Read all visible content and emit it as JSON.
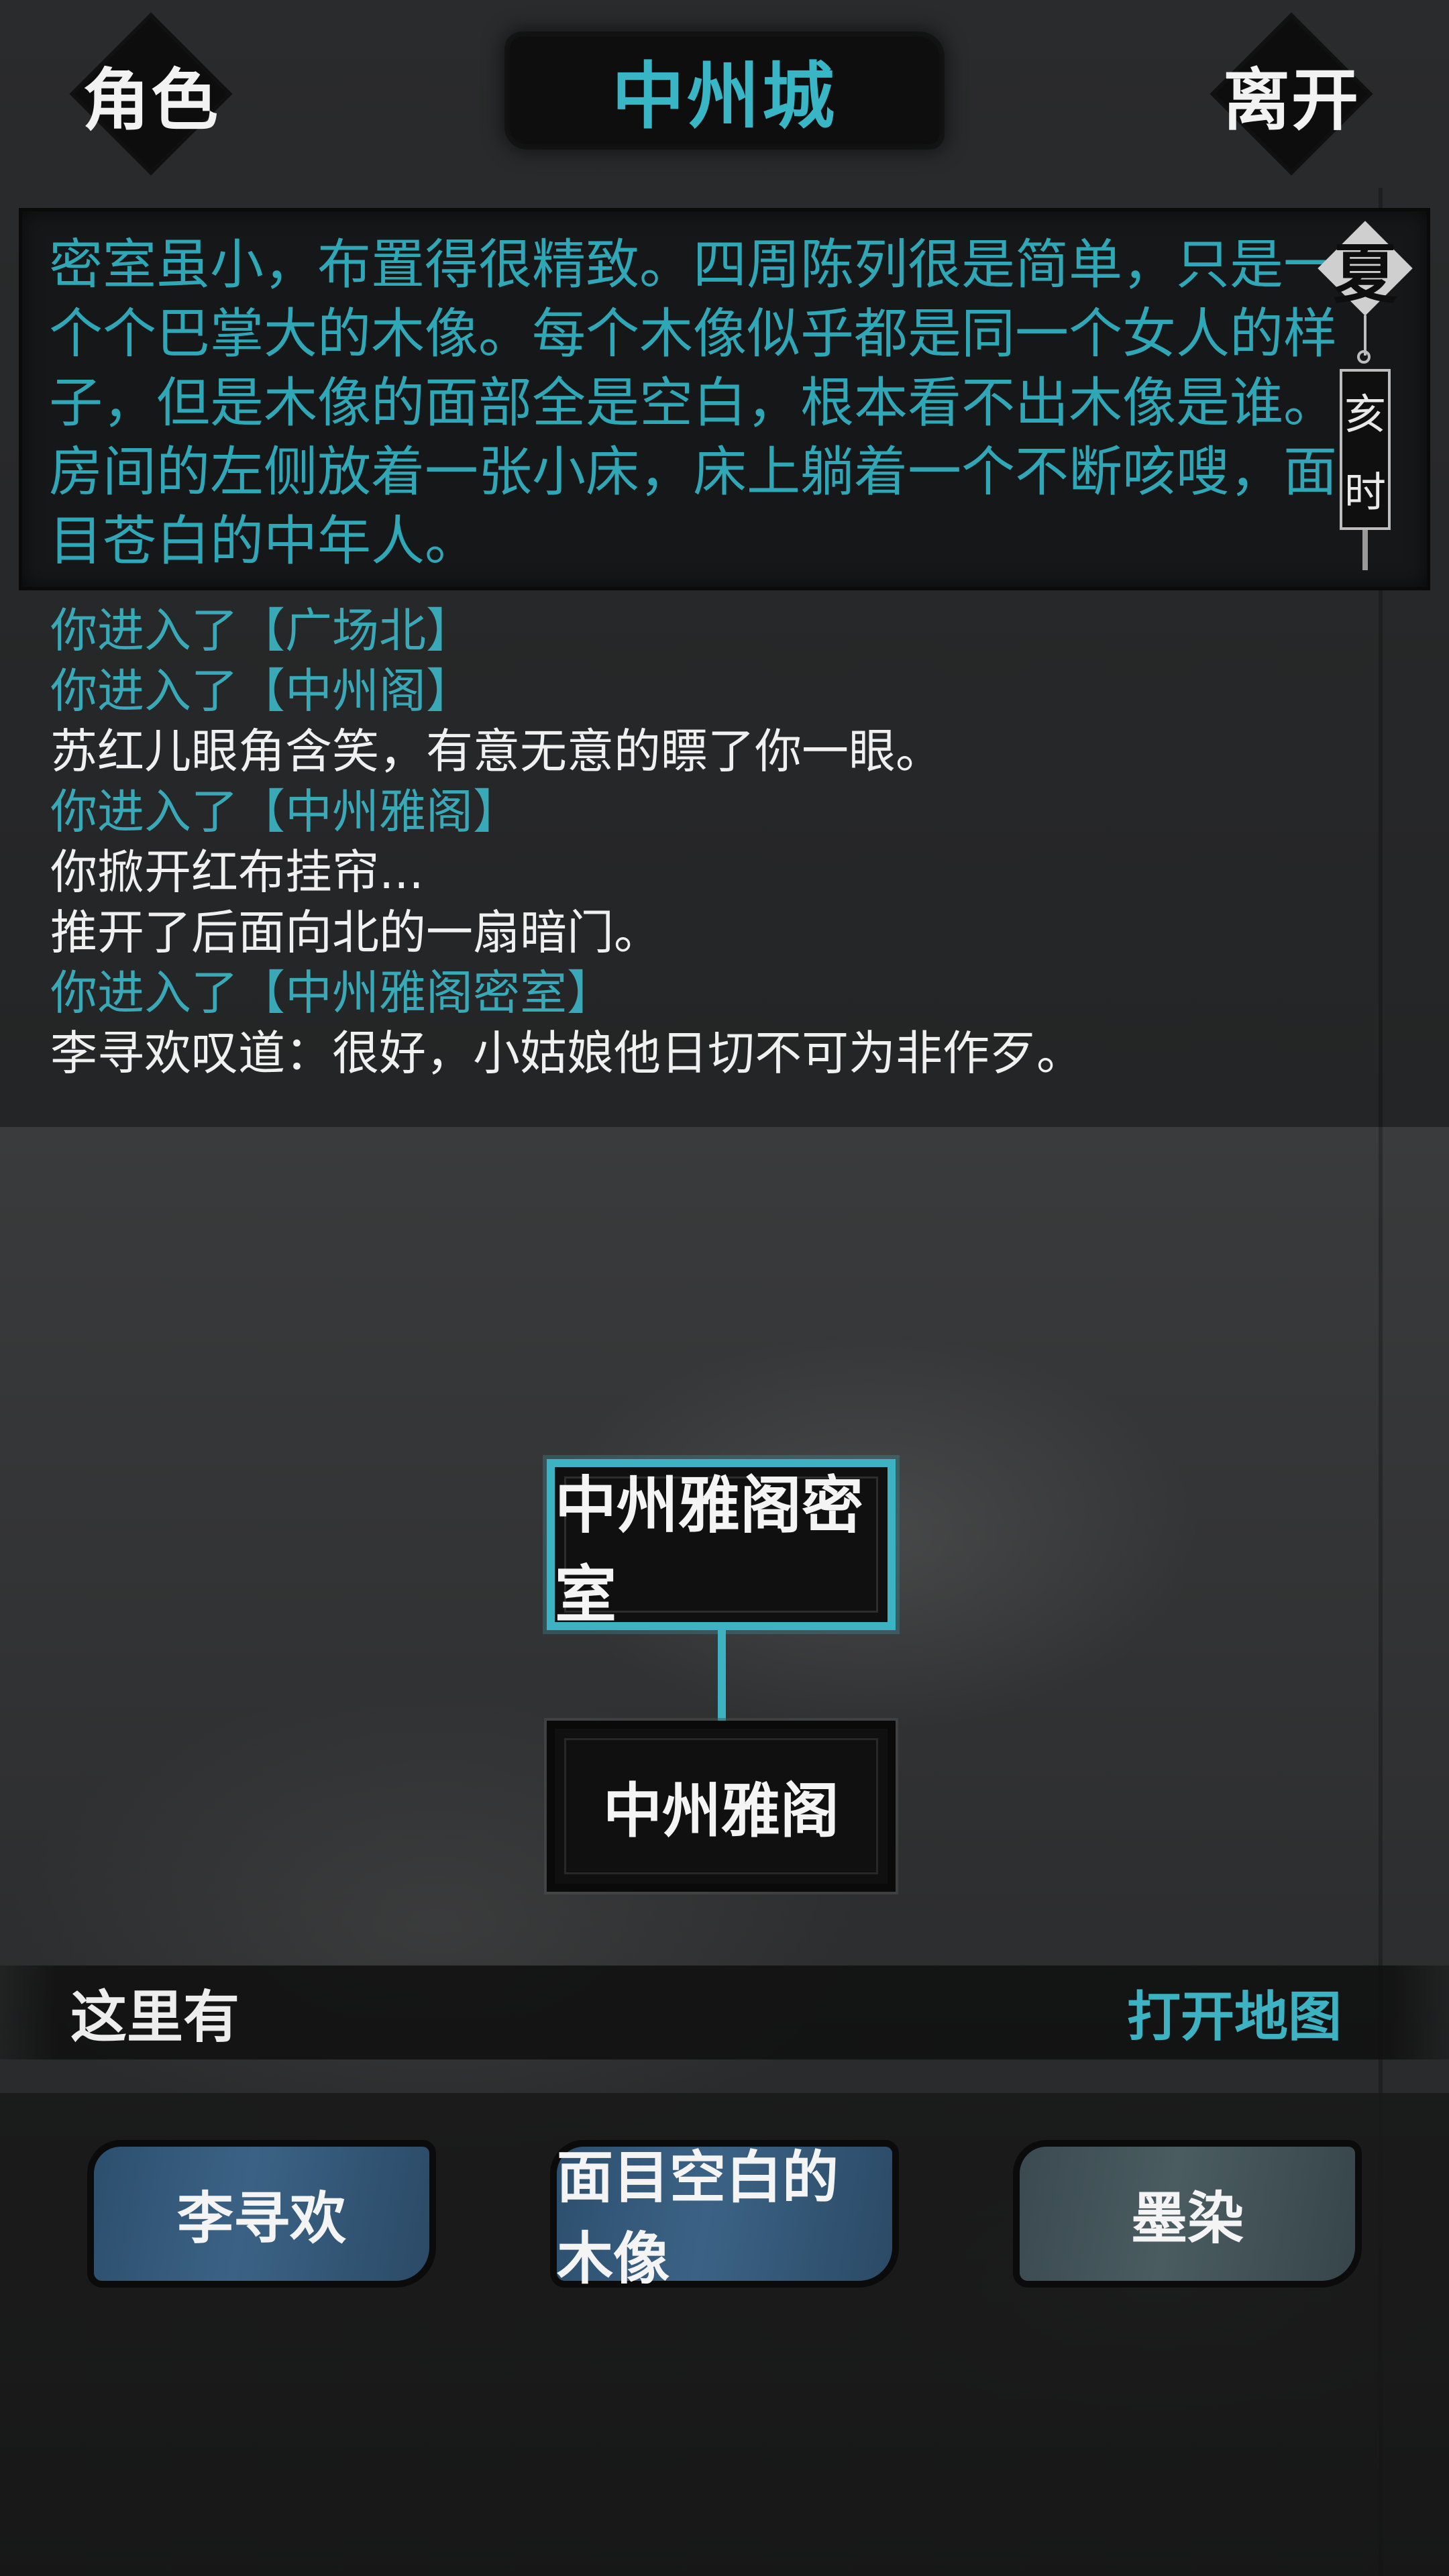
{
  "header": {
    "left_button": "角色",
    "title": "中州城",
    "right_button": "离开"
  },
  "description": "密室虽小，布置得很精致。四周陈列很是简单，只是一个个巴掌大的木像。每个木像似乎都是同一个女人的样子，但是木像的面部全是空白，根本看不出木像是谁。房间的左侧放着一张小床，床上躺着一个不断咳嗖，面目苍白的中年人。",
  "season": {
    "name": "夏",
    "hour_1": "亥",
    "hour_2": "时"
  },
  "log": [
    {
      "type": "enter",
      "text": "你进入了【广场北】"
    },
    {
      "type": "enter",
      "text": "你进入了【中州阁】"
    },
    {
      "type": "plain",
      "text": "苏红儿眼角含笑，有意无意的瞟了你一眼。"
    },
    {
      "type": "enter",
      "text": "你进入了【中州雅阁】"
    },
    {
      "type": "plain",
      "text": "你掀开红布挂帘..."
    },
    {
      "type": "plain",
      "text": "推开了后面向北的一扇暗门。"
    },
    {
      "type": "enter",
      "text": "你进入了【中州雅阁密室】"
    },
    {
      "type": "plain",
      "text": "李寻欢叹道：很好，小姑娘他日切不可为非作歹。"
    }
  ],
  "map": {
    "current": "中州雅阁密室",
    "south": "中州雅阁"
  },
  "here": {
    "label": "这里有",
    "open_map": "打开地图"
  },
  "npcs": [
    {
      "name": "李寻欢",
      "style": "blue"
    },
    {
      "name": "面目空白的木像",
      "style": "blue"
    },
    {
      "name": "墨染",
      "style": "gray"
    }
  ],
  "colors": {
    "accent_cyan": "#3cb2c2",
    "log_cyan": "#39a9b8",
    "background": "#2a2b2c"
  }
}
